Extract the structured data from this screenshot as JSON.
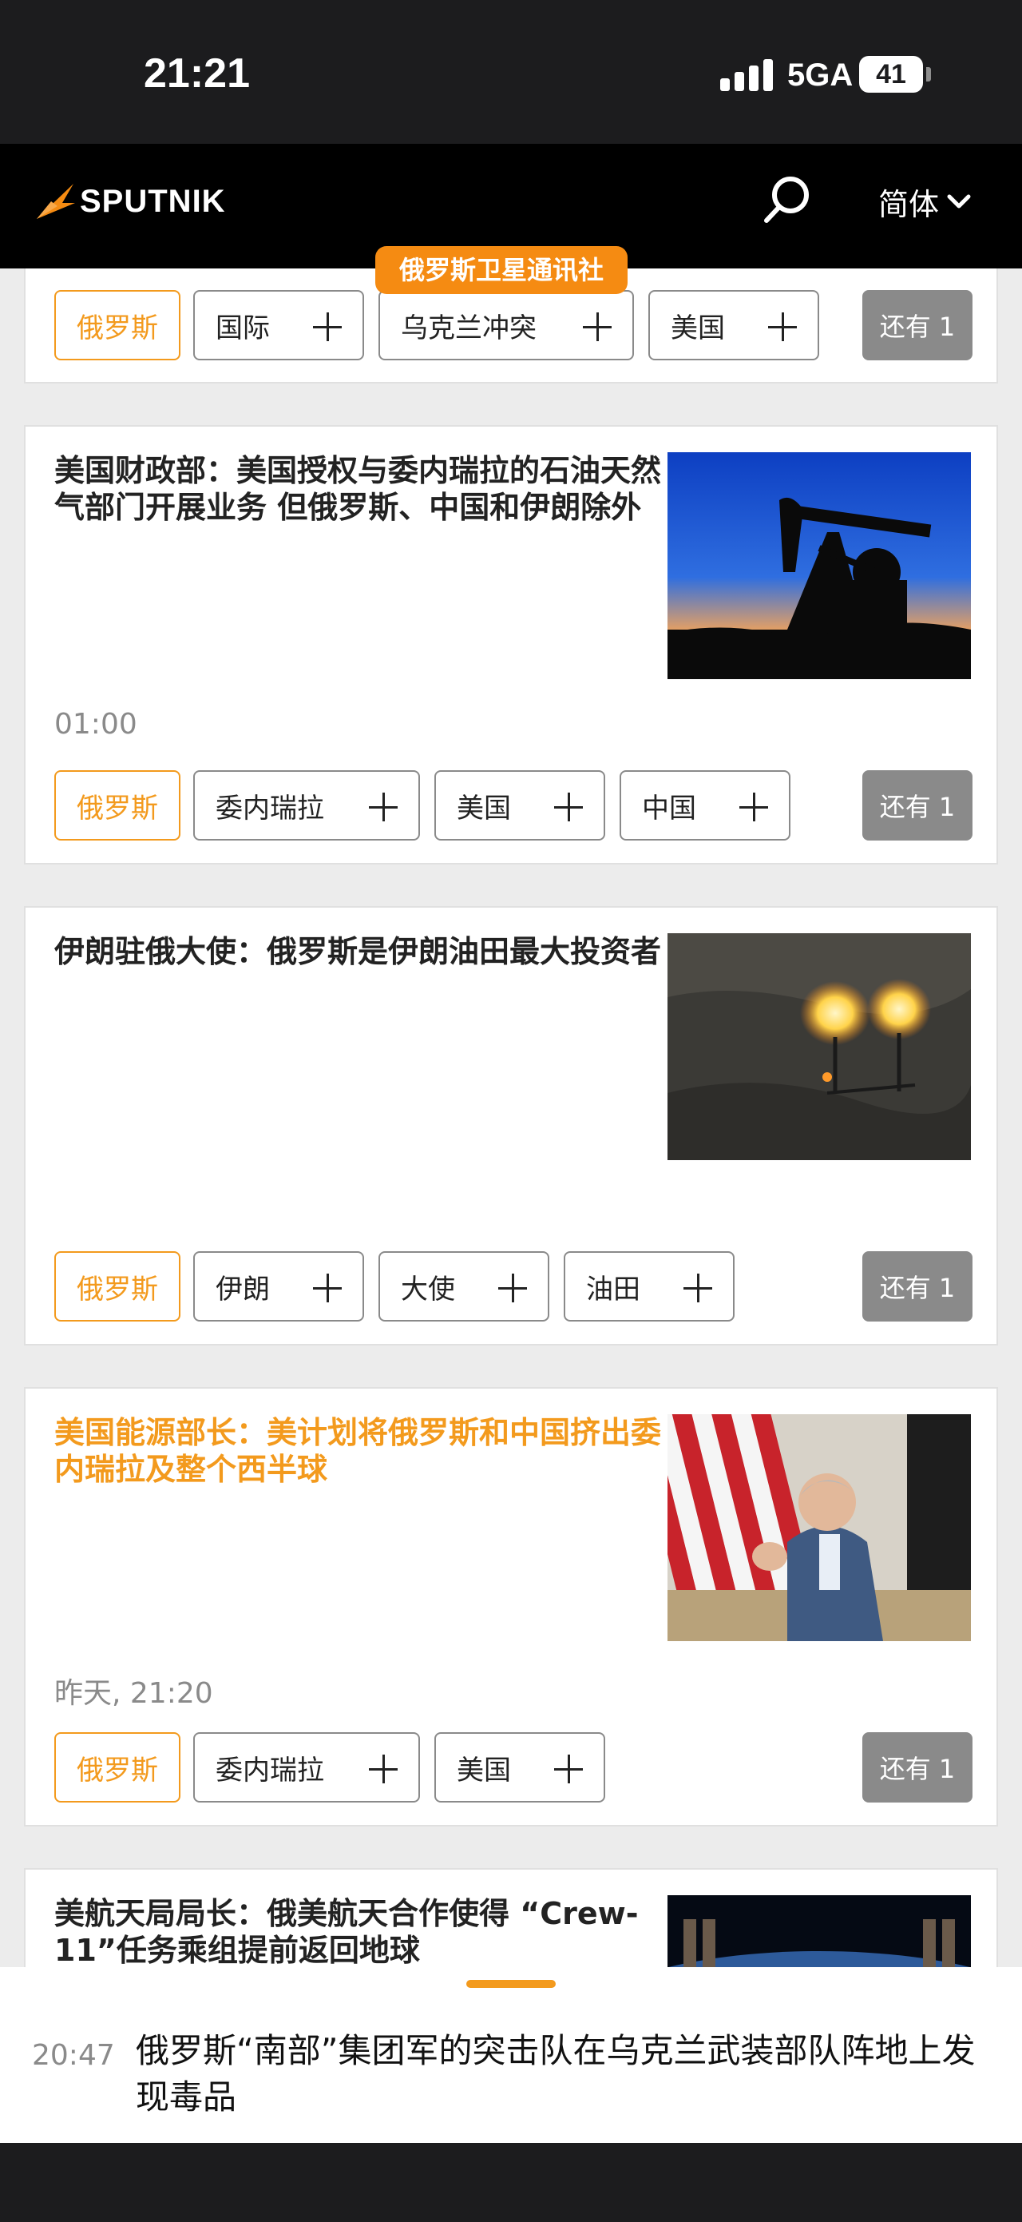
{
  "status_bar": {
    "time": "21:21",
    "network": "5GA",
    "battery": "41"
  },
  "header": {
    "logo_text": "SPUTNIK",
    "language": "简体"
  },
  "brand_badge": "俄罗斯卫星通讯社",
  "articles": [
    {
      "title": "",
      "time": "",
      "primary_tag": "俄罗斯",
      "tags": [
        "国际",
        "乌克兰冲突",
        "美国"
      ],
      "more": "还有 1"
    },
    {
      "title": "美国财政部：美国授权与委内瑞拉的石油天然气部门开展业务 但俄罗斯、中国和伊朗除外",
      "time": "01:00",
      "primary_tag": "俄罗斯",
      "tags": [
        "委内瑞拉",
        "美国",
        "中国"
      ],
      "more": "还有 1"
    },
    {
      "title": "伊朗驻俄大使：俄罗斯是伊朗油田最大投资者",
      "time": "",
      "primary_tag": "俄罗斯",
      "tags": [
        "伊朗",
        "大使",
        "油田"
      ],
      "more": "还有 1"
    },
    {
      "title": "美国能源部长：美计划将俄罗斯和中国挤出委内瑞拉及整个西半球",
      "time": "昨天, 21:20",
      "primary_tag": "俄罗斯",
      "tags": [
        "委内瑞拉",
        "美国"
      ],
      "more": "还有 1"
    },
    {
      "title": "美航天局局长：俄美航天合作使得 “Crew-11”任务乘组提前返回地球"
    }
  ],
  "ticker": {
    "time": "20:47",
    "text": "俄罗斯“南部”集团军的突击队在乌克兰武装部队阵地上发现毒品"
  },
  "colors": {
    "accent": "#f39a1d",
    "badge": "#f58b12",
    "header_bg": "#000000"
  },
  "icons": [
    "sputnik-logo-icon",
    "search-icon",
    "chevron-down-icon",
    "plus-icon"
  ]
}
